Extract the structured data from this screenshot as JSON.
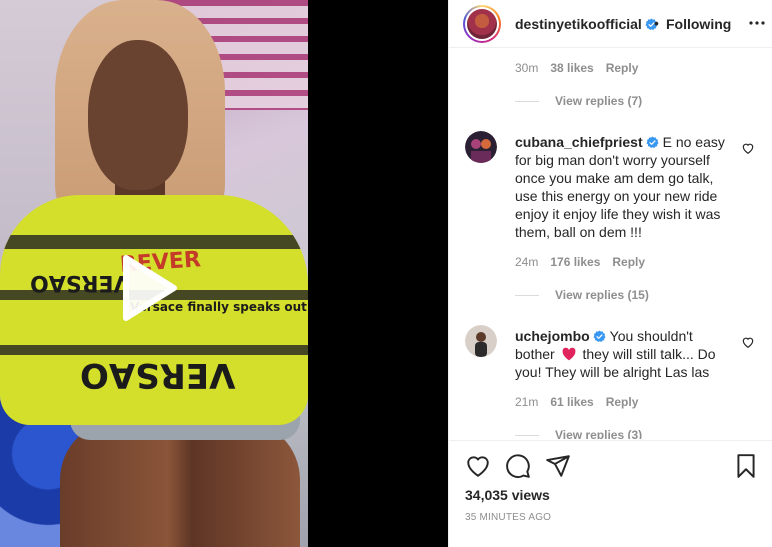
{
  "post": {
    "username": "destinyetikoofficial",
    "dot": "•",
    "follow_status": "Following"
  },
  "comments_top": {
    "time": "30m",
    "likes": "38 likes",
    "reply": "Reply",
    "view_replies": "View replies (7)"
  },
  "comments": [
    {
      "username": "cubana_chiefpriest",
      "text": "E no easy for big man don't worry yourself once you make am dem go talk, use this energy on your new ride enjoy it enjoy life they wish it was them, ball on dem !!!",
      "time": "24m",
      "likes": "176 likes",
      "reply": "Reply",
      "view_replies": "View replies (15)"
    },
    {
      "username": "uchejombo",
      "text_before_emoji": "You shouldn't bother",
      "text_after_emoji": "they will still talk... Do you! They will be alright Las las",
      "time": "21m",
      "likes": "61 likes",
      "reply": "Reply",
      "view_replies": "View replies (3)"
    }
  ],
  "footer": {
    "views": "34,035 views",
    "posted": "35 MINUTES AGO"
  },
  "icons": {
    "verified": "verified-badge-icon",
    "more": "more-options-icon",
    "like": "heart-icon",
    "comment": "comment-icon",
    "share": "paper-plane-icon",
    "save": "bookmark-icon",
    "play": "play-icon"
  },
  "colors": {
    "verified_blue": "#3897f0",
    "emoji_red": "#e0245e",
    "muted_text": "#8e8e8e"
  }
}
